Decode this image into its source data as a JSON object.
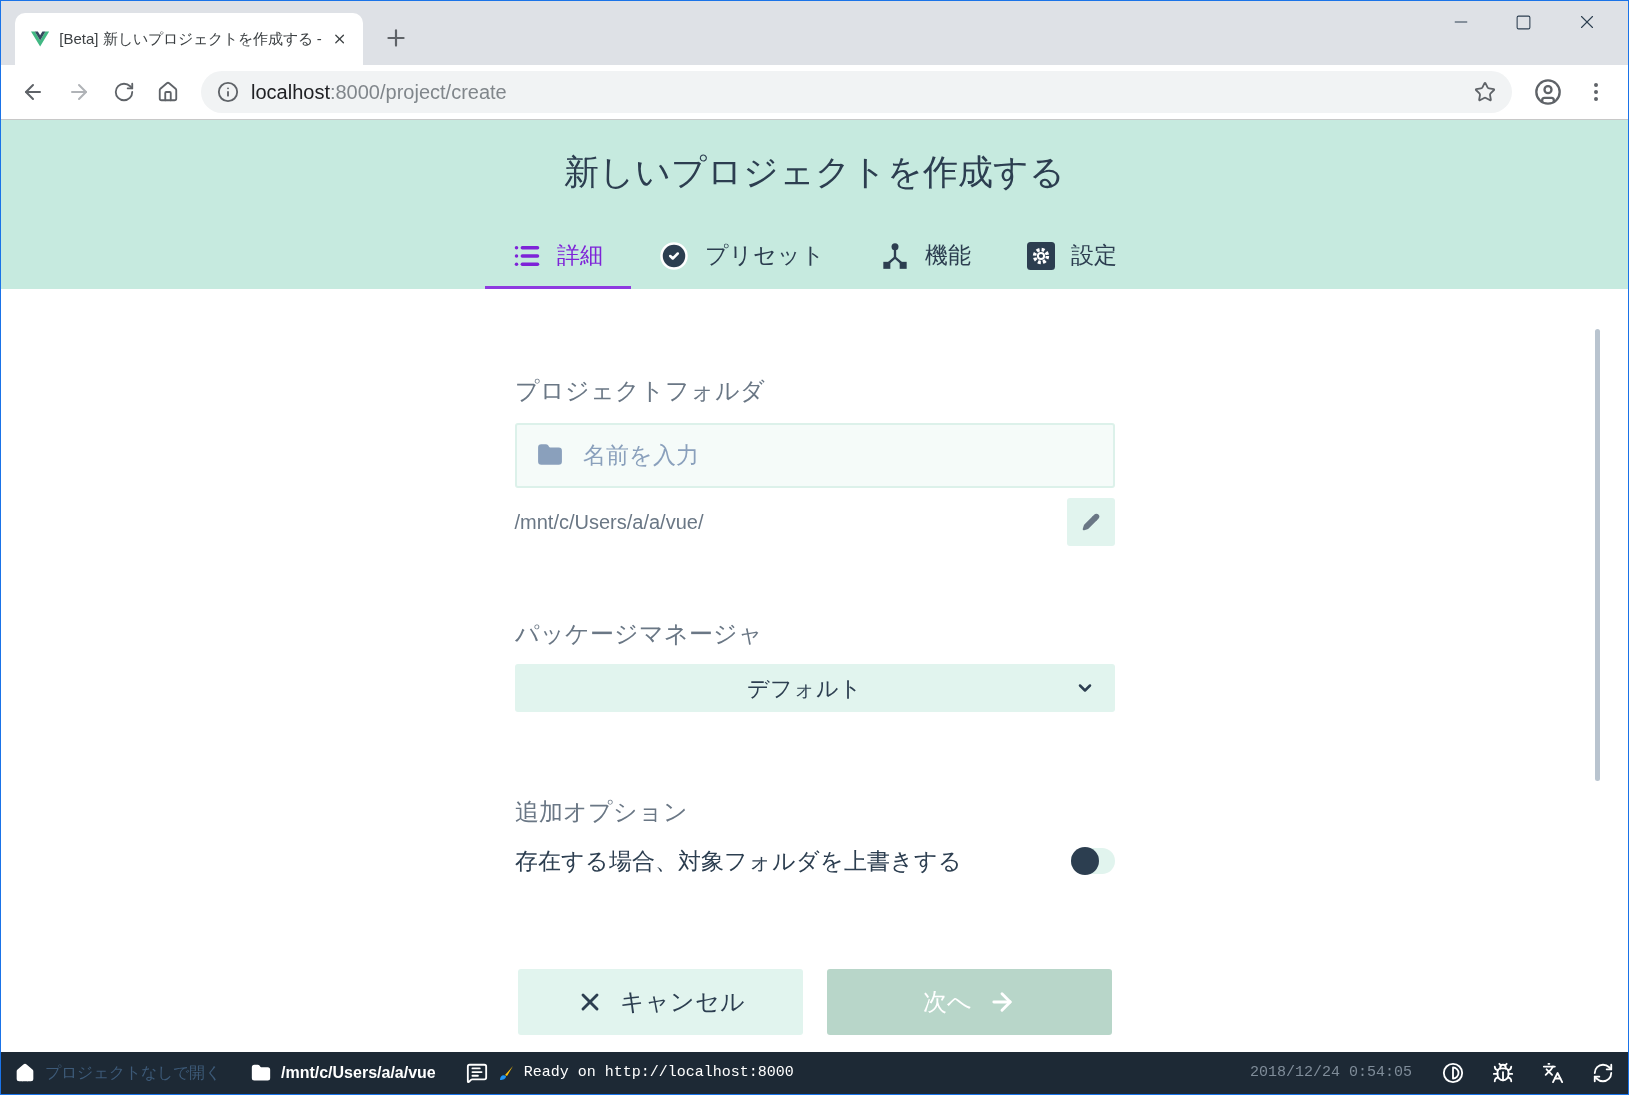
{
  "browser": {
    "tab_title": "[Beta] 新しいプロジェクトを作成する -",
    "url_host": "localhost",
    "url_path": ":8000/project/create"
  },
  "page": {
    "title": "新しいプロジェクトを作成する",
    "tabs": [
      {
        "label": "詳細",
        "kind": "list",
        "selected": true
      },
      {
        "label": "プリセット",
        "kind": "check",
        "selected": false
      },
      {
        "label": "機能",
        "kind": "fork",
        "selected": false
      },
      {
        "label": "設定",
        "kind": "gear",
        "selected": false
      }
    ],
    "folder_label": "プロジェクトフォルダ",
    "folder_placeholder": "名前を入力",
    "folder_path": "/mnt/c/Users/a/a/vue/",
    "package_manager_label": "パッケージマネージャ",
    "package_manager_value": "デフォルト",
    "options_label": "追加オプション",
    "overwrite": {
      "label": "存在する場合、対象フォルダを上書きする",
      "on": false
    },
    "buttons": [
      {
        "kind": "cancel",
        "label": "キャンセル",
        "disabled": false
      },
      {
        "kind": "next",
        "label": "次へ",
        "disabled": true
      }
    ]
  },
  "status_bar": {
    "home": "プロジェクトなしで開く",
    "folder": "/mnt/c/Users/a/a/vue",
    "log": "Ready on http://localhost:8000",
    "time": "2018/12/24 0:54:05"
  }
}
